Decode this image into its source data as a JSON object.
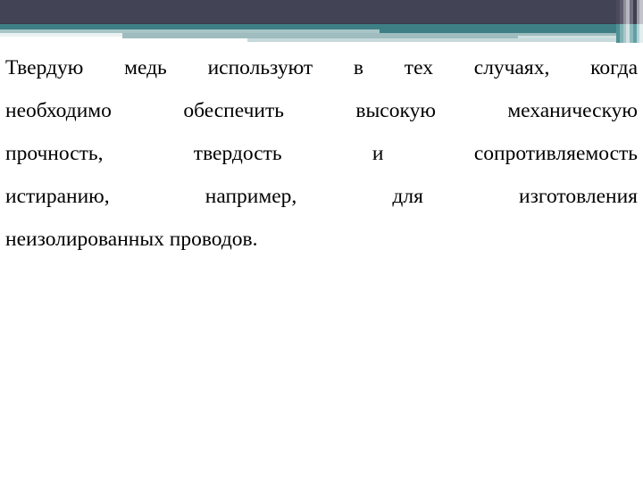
{
  "slide": {
    "background_color": "#ffffff",
    "banner": {
      "dark_band_color": "#434356",
      "teal_band_color": "#3d7f85",
      "mid_band_color": "#a9c4c6",
      "pale_band_color": "#c6dadc"
    },
    "edge_stripes": {
      "colors_top": [
        "#4a4a5c",
        "#5d5d6e",
        "#8e8e9c",
        "#b6b6c0",
        "#6f6f80",
        "#3f3f50",
        "#9a9aa6",
        "#c3c3cb"
      ],
      "colors_bottom": [
        "#4e9197",
        "#7fb0b3",
        "#a9c6c8",
        "#cfe1e2",
        "#8fbabd",
        "#5fa0a5",
        "#b7d2d4",
        "#e2eeee"
      ]
    },
    "text": {
      "paragraph": "Твердую медь используют в тех случаях, когда необходимо обеспечить высокую механическую прочность, твердость и сопротивляемость истиранию, например, для изготовления неизолированных проводов.",
      "lines": [
        "Твердую медь используют в тех случаях, когда",
        "необходимо обеспечить высокую механическую",
        "прочность, твердость и сопротивляемость",
        "истиранию, например, для изготовления",
        "неизолированных проводов."
      ],
      "color": "#000000",
      "alignment": "justify"
    }
  }
}
